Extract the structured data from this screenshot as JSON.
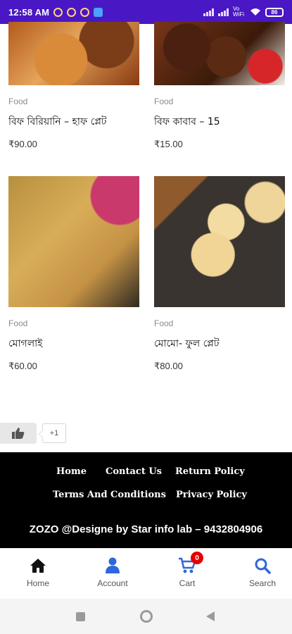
{
  "status_bar": {
    "time": "12:58 AM",
    "network_label": "Vo WiFi",
    "battery": "86",
    "background": "#4a17c4"
  },
  "products": [
    {
      "category": "Food",
      "name": "বিফ বিরিয়ানি – হাফ প্লেট",
      "price": "₹90.00",
      "image_icon": "biryani-image"
    },
    {
      "category": "Food",
      "name": "বিফ কাবাব – 15",
      "price": "₹15.00",
      "image_icon": "kebab-image"
    },
    {
      "category": "Food",
      "name": "মোগলাই",
      "price": "₹60.00",
      "image_icon": "mughlai-image"
    },
    {
      "category": "Food",
      "name": "মোমো- ফুল প্লেট",
      "price": "₹80.00",
      "image_icon": "momo-image"
    }
  ],
  "like": {
    "count_label": "+1",
    "icon": "thumbs-up-icon"
  },
  "footer": {
    "links": [
      "Home",
      "Contact Us",
      "Return Policy",
      "Terms And Conditions",
      "Privacy Policy"
    ],
    "copyright": "ZOZO @Designe by Star info lab – 9432804906",
    "background": "#000000"
  },
  "bottom_nav": {
    "items": [
      {
        "label": "Home",
        "icon": "home-icon",
        "color": "#111111"
      },
      {
        "label": "Account",
        "icon": "user-icon",
        "color": "#2f67d8"
      },
      {
        "label": "Cart",
        "icon": "cart-icon",
        "color": "#2f67d8",
        "badge": "0"
      },
      {
        "label": "Search",
        "icon": "search-icon",
        "color": "#2f67d8"
      }
    ]
  },
  "system_nav": {
    "icons": [
      "recent-apps-icon",
      "home-button-icon",
      "back-icon"
    ]
  }
}
